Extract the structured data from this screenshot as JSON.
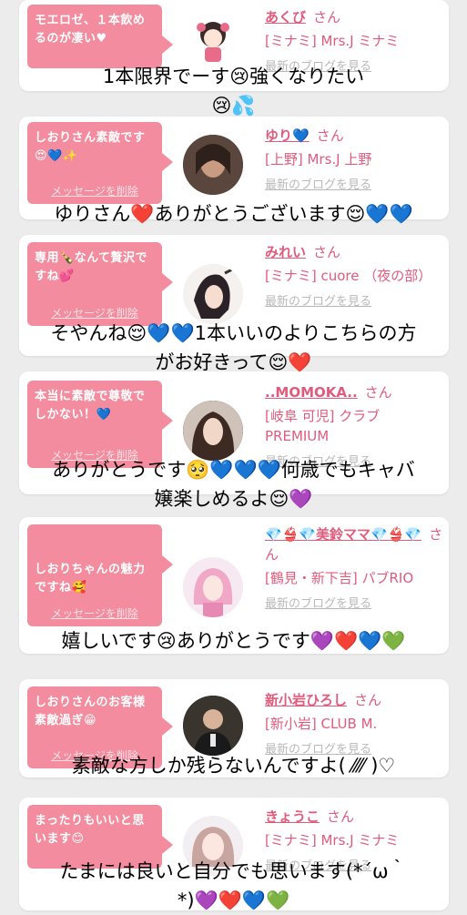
{
  "items": [
    {
      "message": "モエロゼ、１本飲めるのが凄い♥",
      "delete": "",
      "name": "あくび",
      "san": "さん",
      "shop": "[ミナミ] Mrs.J ミナミ",
      "blog": "最新のブログを見る",
      "reply_1": "1本限界でーす😢強くなりたい",
      "reply_2": "😢💦"
    },
    {
      "message": "しおりさん素敵です😍💙✨",
      "delete": "メッセージを削除",
      "name": "ゆり💙",
      "san": "さん",
      "shop": "[上野] Mrs.J 上野",
      "blog": "最新のブログを見る",
      "reply_1": "ゆりさん❤️ありがとうございます😌💙💙",
      "reply_2": ""
    },
    {
      "message": "専用🍾なんて贅沢ですね💕",
      "delete": "メッセージを削除",
      "name": "みれい",
      "san": "さん",
      "shop": "[ミナミ] cuore （夜の部）",
      "blog": "最新のブログを見る",
      "reply_1": "そやんね😌💙💙1本いいのよりこちらの方",
      "reply_2": "がお好きって😌❤️"
    },
    {
      "message": "本当に素敵で尊敬でしかない！💙",
      "delete": "メッセージを削除",
      "name": "..MOMOKA..",
      "san": "さん",
      "shop": "[岐阜 可児] クラブPREMIUM",
      "blog": "最新のブログを見る",
      "reply_1": "ありがとうです🥺💙💙💙何歳でもキャバ",
      "reply_2": "嬢楽しめるよ😌💜"
    },
    {
      "message": "しおりちゃんの魅力ですね🥰",
      "delete": "メッセージを削除",
      "name": "💎👙💎美鈴ママ💎👙💎",
      "san": "さん",
      "shop": "[鶴見・新下吉] パブRIO",
      "blog": "最新のブログを見る",
      "reply_1": "嬉しいです😢ありがとうです💜❤️💙💚",
      "reply_2": ""
    },
    {
      "message": "しおりさんのお客様素敵過ぎ😁",
      "delete": "メッセージを削除",
      "name": "新小岩ひろし",
      "san": "さん",
      "shop": "[新小岩] CLUB M.",
      "blog": "最新のブログを見る",
      "reply_1": "素敵な方しか残らないんですよ(  ⁄⁄⁄⁄  )♡",
      "reply_2": ""
    },
    {
      "message": "まったりもいいと思います😊",
      "delete": "",
      "name": "きょうこ",
      "san": "さん",
      "shop": "[ミナミ] Mrs.J ミナミ",
      "blog": "最新のブログを見る",
      "reply_1": "たまには良いと自分でも思います(*´ω｀",
      "reply_2": "*)💜❤️💙💚"
    }
  ]
}
